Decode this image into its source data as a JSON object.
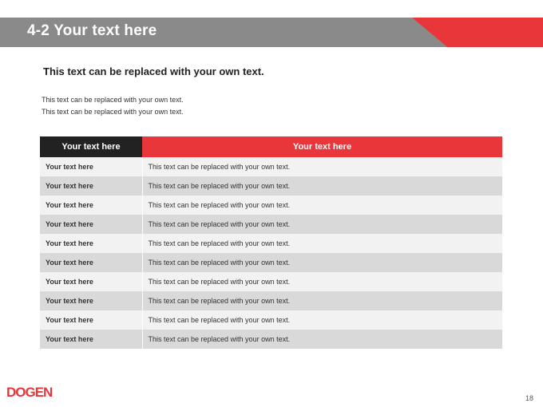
{
  "header": {
    "title": "4-2 Your text here"
  },
  "subtitle": "This text can be replaced with your own text.",
  "body_lines": [
    "This text can be replaced with your own text.",
    "This text can be replaced with your own text."
  ],
  "table": {
    "headers": [
      "Your text here",
      "Your text here"
    ],
    "rows": [
      [
        "Your text here",
        "This text can be replaced with your own text."
      ],
      [
        "Your text here",
        "This text can be replaced with your own text."
      ],
      [
        "Your text here",
        "This text can be replaced with your own text."
      ],
      [
        "Your text here",
        "This text can be replaced with your own text."
      ],
      [
        "Your text here",
        "This text can be replaced with your own text."
      ],
      [
        "Your text here",
        "This text can be replaced with your own text."
      ],
      [
        "Your text here",
        "This text can be replaced with your own text."
      ],
      [
        "Your text here",
        "This text can be replaced with your own text."
      ],
      [
        "Your text here",
        "This text can be replaced with your own text."
      ],
      [
        "Your text here",
        "This text can be replaced with your own text."
      ]
    ]
  },
  "logo": {
    "text": "DOGEN"
  },
  "page_number": "18",
  "colors": {
    "accent": "#e8363b",
    "bar": "#8a8a8a",
    "dark": "#222222"
  }
}
